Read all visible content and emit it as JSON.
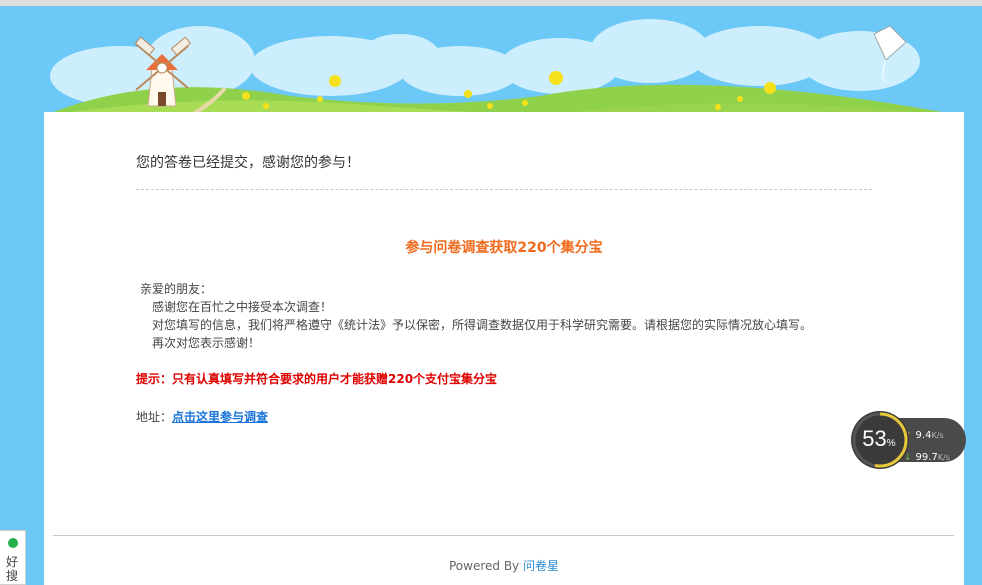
{
  "survey": {
    "thanks_message": "您的答卷已经提交，感谢您的参与！",
    "promo_title": "参与问卷调查获取220个集分宝",
    "greeting": "亲爱的朋友：",
    "lines": [
      "感谢您在百忙之中接受本次调查！",
      "对您填写的信息，我们将严格遵守《统计法》予以保密，所得调查数据仅用于科学研究需要。请根据您的实际情况放心填写。",
      "再次对您表示感谢！"
    ],
    "tip": "提示：只有认真填写并符合要求的用户才能获赠220个支付宝集分宝",
    "address_label": "地址：",
    "address_link": "点击这里参与调查"
  },
  "footer": {
    "powered_by": "Powered By",
    "brand": "问卷星"
  },
  "speed_widget": {
    "percent": "53",
    "percent_sign": "%",
    "percent_value": 53,
    "upload": "9.4",
    "download": "99.7",
    "unit": "K/s"
  },
  "side_widget": {
    "text": "好搜"
  },
  "colors": {
    "sky": "#6cc8f6",
    "promo": "#f06a1d",
    "tip": "#e00000",
    "link": "#1a73d9"
  }
}
